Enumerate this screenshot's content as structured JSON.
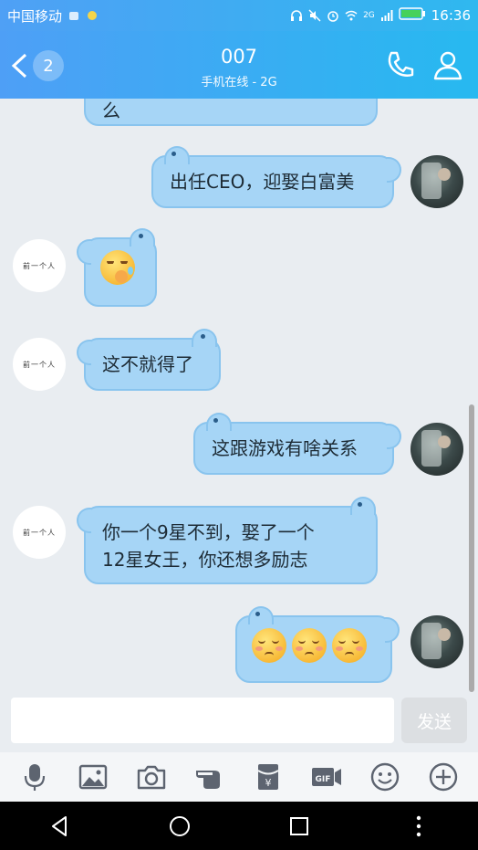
{
  "status_bar": {
    "carrier": "中国移动",
    "network": "2G",
    "time": "16:36"
  },
  "header": {
    "unread_count": "2",
    "contact_name": "007",
    "contact_status": "手机在线 - 2G"
  },
  "messages": [
    {
      "from": "friend",
      "text": "么"
    },
    {
      "from": "me",
      "text": "出任CEO，迎娶白富美"
    },
    {
      "from": "friend",
      "text": "",
      "emoji": "thinking-face"
    },
    {
      "from": "friend",
      "text": "这不就得了"
    },
    {
      "from": "me",
      "text": "这跟游戏有啥关系"
    },
    {
      "from": "friend",
      "text_line1": "你一个9星不到，娶了一个",
      "text_line2": "12星女王，你还想多励志"
    },
    {
      "from": "me",
      "text": "",
      "emoji": "blushing-face",
      "emoji_count": 3
    }
  ],
  "friend_avatar_text": "前一个人",
  "input": {
    "value": "",
    "send_label": "发送"
  },
  "toolbar": [
    "mic-icon",
    "image-icon",
    "camera-icon",
    "poke-icon",
    "red-packet-icon",
    "gif-icon",
    "emoji-icon",
    "plus-icon"
  ],
  "colors": {
    "header_start": "#4e9ff6",
    "header_end": "#27b9f0",
    "bubble": "#a6d5f6",
    "bubble_border": "#89c4ee",
    "background": "#e9edf1"
  }
}
